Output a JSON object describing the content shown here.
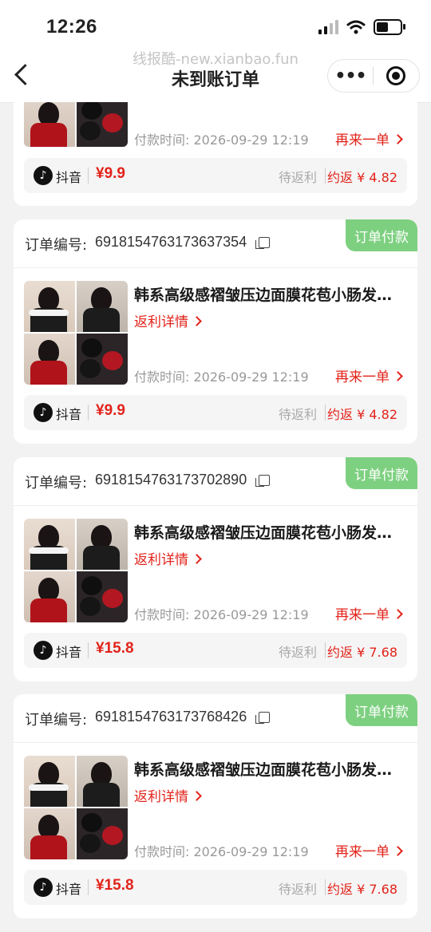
{
  "status_bar": {
    "time": "12:26"
  },
  "nav": {
    "watermark": "线报酷-new.xianbao.fun",
    "title": "未到账订单",
    "more": "•••"
  },
  "labels": {
    "order_no_label": "订单编号:",
    "pay_badge": "订单付款",
    "rebate_details": "返利详情",
    "reorder": "再来一单",
    "platform": "抖音",
    "status": "待返利",
    "tiktok_glyph": "♪"
  },
  "first_card": {
    "pay_time": "付款时间: 2026-09-29 12:19",
    "price": "¥9.9",
    "estimate": "约返 ¥ 4.82"
  },
  "orders": [
    {
      "order_no": "6918154763173637354",
      "title": "韩系高级感褶皱压边面膜花苞小肠发…",
      "pay_time": "付款时间: 2026-09-29 12:19",
      "price": "¥9.9",
      "estimate": "约返 ¥ 4.82"
    },
    {
      "order_no": "6918154763173702890",
      "title": "韩系高级感褶皱压边面膜花苞小肠发…",
      "pay_time": "付款时间: 2026-09-29 12:19",
      "price": "¥15.8",
      "estimate": "约返 ¥ 7.68"
    },
    {
      "order_no": "6918154763173768426",
      "title": "韩系高级感褶皱压边面膜花苞小肠发…",
      "pay_time": "付款时间: 2026-09-29 12:19",
      "price": "¥15.8",
      "estimate": "约返 ¥ 7.68"
    }
  ],
  "colors": {
    "accent": "#e2231a",
    "badge": "#7ed081",
    "muted": "#999999"
  }
}
